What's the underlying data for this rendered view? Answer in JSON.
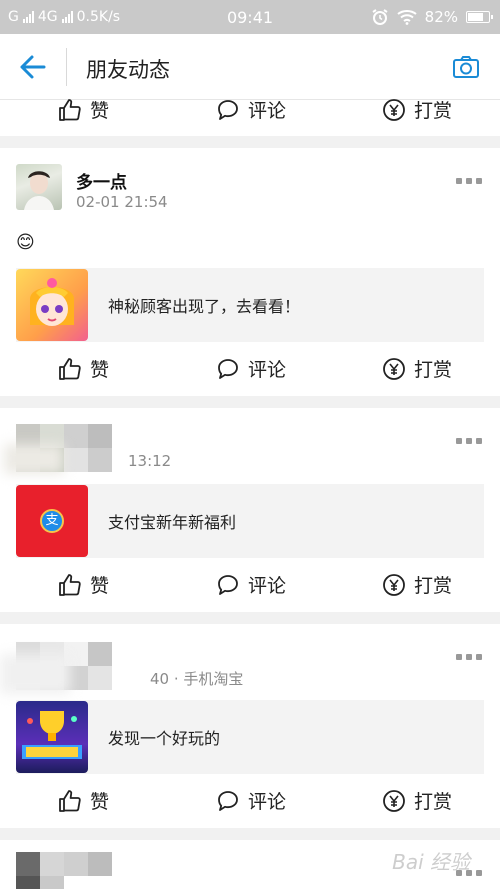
{
  "status_bar": {
    "network_left": "G",
    "network_4g": "4G",
    "speed": "0.5K/s",
    "time": "09:41",
    "battery": "82%"
  },
  "header": {
    "title": "朋友动态"
  },
  "actions": {
    "like": "赞",
    "comment": "评论",
    "reward": "打赏"
  },
  "posts": [
    {
      "author": "多一点",
      "time": "02-01 21:54",
      "emoji": "😊",
      "share_text": "神秘顾客出现了，去看看！"
    },
    {
      "author": "",
      "time": "13:12",
      "share_text": "支付宝新年新福利",
      "app_icon_text": "支"
    },
    {
      "author": "",
      "time": "40 · 手机淘宝",
      "share_text": "发现一个好玩的"
    }
  ],
  "watermark": "Bai 经验",
  "colors": {
    "accent": "#1a8bd6",
    "redpacket": "#e8202c",
    "alipay_blue": "#1e8ce8"
  }
}
